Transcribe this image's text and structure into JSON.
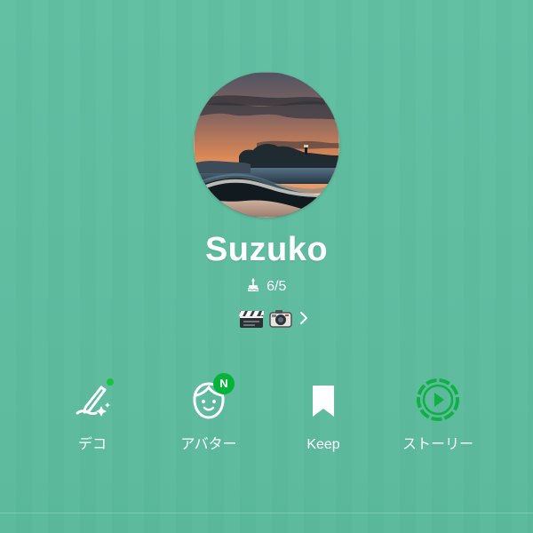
{
  "profile": {
    "name": "Suzuko",
    "birthday": "6/5",
    "status_emojis": [
      "clapper-board",
      "camera"
    ]
  },
  "actions": [
    {
      "label": "デコ",
      "icon": "deco-pen-icon",
      "badge": "dot"
    },
    {
      "label": "アバター",
      "icon": "avatar-icon",
      "badge": "N"
    },
    {
      "label": "Keep",
      "icon": "bookmark-icon",
      "badge": ""
    },
    {
      "label": "ストーリー",
      "icon": "story-play-icon",
      "badge": ""
    }
  ],
  "colors": {
    "background": "#5dbd9f",
    "text": "#ffffff",
    "badge_green": "#06b33a",
    "story_green": "#0fb144"
  }
}
